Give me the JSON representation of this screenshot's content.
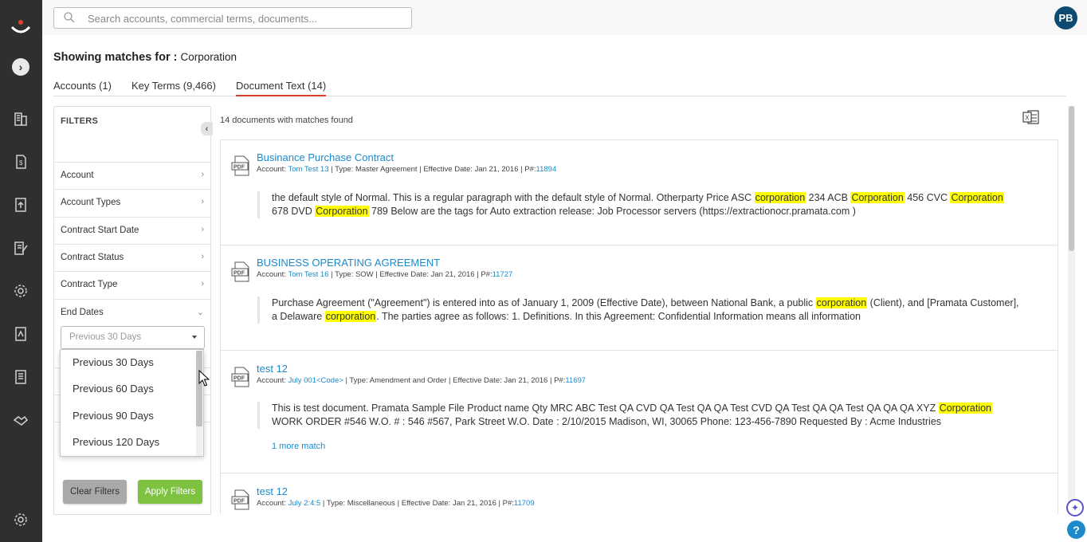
{
  "search": {
    "placeholder": "Search accounts, commercial terms, documents..."
  },
  "user": {
    "initials": "PB"
  },
  "heading": {
    "label": "Showing matches for :",
    "term": "Corporation"
  },
  "tabs": [
    {
      "label": "Accounts (1)"
    },
    {
      "label": "Key Terms (9,466)"
    },
    {
      "label": "Document Text (14)",
      "active": true
    }
  ],
  "filters": {
    "title": "FILTERS",
    "items": [
      {
        "label": "Account"
      },
      {
        "label": "Account Types"
      },
      {
        "label": "Contract Start Date"
      },
      {
        "label": "Contract Status"
      },
      {
        "label": "Contract Type"
      },
      {
        "label": "End Dates",
        "expanded": true
      }
    ],
    "end_dates": {
      "selected": "Previous 30 Days",
      "options": [
        "Previous 30 Days",
        "Previous 60 Days",
        "Previous 90 Days",
        "Previous 120 Days"
      ]
    },
    "clear_label": "Clear Filters",
    "apply_label": "Apply Filters"
  },
  "results": {
    "count_text": "14 documents with matches found",
    "items": [
      {
        "title": "Businance Purchase Contract",
        "account": "Tom Test 13",
        "type": "Master Agreement",
        "effective_date": "Jan 21, 2016",
        "pnum": "11894",
        "snippet_parts": [
          {
            "t": "the default style of Normal. This is a regular paragraph with the default style of Normal. Otherparty Price ASC "
          },
          {
            "t": "corporation",
            "hl": true
          },
          {
            "t": " 234 ACB "
          },
          {
            "t": "Corporation",
            "hl": true
          },
          {
            "t": " 456 CVC "
          },
          {
            "t": "Corporation",
            "hl": true
          },
          {
            "t": " 678 DVD "
          },
          {
            "t": "Corporation",
            "hl": true
          },
          {
            "t": " 789 Below are the tags for Auto extraction release: Job Processor servers (https://extractionocr.pramata.com )"
          }
        ]
      },
      {
        "title": "BUSINESS OPERATING AGREEMENT",
        "account": "Tom Test 16",
        "type": "SOW",
        "effective_date": "Jan 21, 2016",
        "pnum": "11727",
        "snippet_parts": [
          {
            "t": "Purchase Agreement (\"Agreement\") is entered into as of January 1, 2009 (Effective Date), between National Bank, a public "
          },
          {
            "t": "corporation",
            "hl": true
          },
          {
            "t": " (Client), and [Pramata Customer], a Delaware "
          },
          {
            "t": "corporation",
            "hl": true
          },
          {
            "t": ". The parties agree as follows: 1. Definitions. In this Agreement: Confidential Information means all information"
          }
        ]
      },
      {
        "title": "test 12",
        "account": "July 001<Code>",
        "type": "Amendment and Order",
        "effective_date": "Jan 21, 2016",
        "pnum": "11697",
        "snippet_parts": [
          {
            "t": "This is test document. Pramata Sample File Product name Qty MRC ABC Test QA CVD QA Test QA QA Test CVD QA Test QA QA Test QA QA QA XYZ "
          },
          {
            "t": "Corporation",
            "hl": true
          },
          {
            "t": " WORK ORDER #546 W.O. # : 546 #567, Park Street W.O. Date : 2/10/2015 Madison, WI, 30065 Phone: 123-456-7890 Requested By : Acme Industries"
          }
        ],
        "more": "1 more match"
      },
      {
        "title": "test 12",
        "account": "July 2:4:5",
        "type": "Miscellaneous",
        "effective_date": "Jan 21, 2016",
        "pnum": "11709",
        "snippet_parts": []
      }
    ]
  },
  "meta_labels": {
    "account": "Account: ",
    "type": "Type: ",
    "effective": "Effective Date: ",
    "pnum": "P#:"
  },
  "icons": [
    "logo-icon",
    "expand-icon",
    "buildings-icon",
    "invoice-icon",
    "upload-icon",
    "edit-document-icon",
    "settings-gear-icon",
    "report-icon",
    "document-list-icon",
    "handshake-icon",
    "gear-icon",
    "search-icon",
    "excel-export-icon",
    "pdf-icon",
    "lightbulb-icon",
    "help-icon"
  ]
}
